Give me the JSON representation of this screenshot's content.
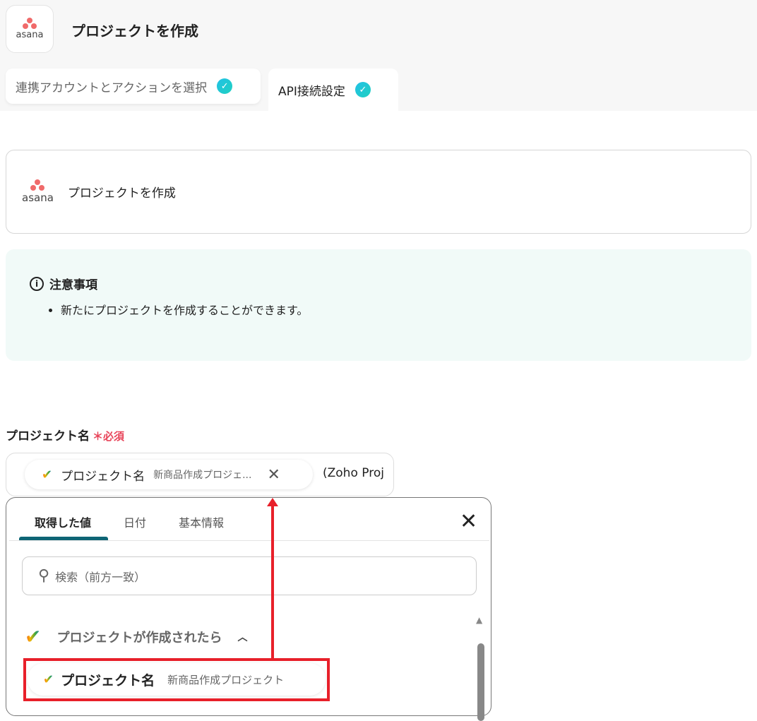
{
  "header": {
    "title": "プロジェクトを作成",
    "logo_text": "asana"
  },
  "tabs": [
    {
      "label": "連携アカウントとアクションを選択"
    },
    {
      "label": "API接続設定"
    }
  ],
  "action_card": {
    "title": "プロジェクトを作成",
    "logo_text": "asana"
  },
  "notice": {
    "title": "注意事項",
    "items": [
      "新たにプロジェクトを作成することができます。"
    ]
  },
  "field": {
    "label": "プロジェクト名",
    "required": "必須",
    "pill_label": "プロジェクト名",
    "pill_value": "新商品作成プロジェ...",
    "trailing_text": "(Zoho Proj"
  },
  "popup": {
    "tabs": [
      "取得した値",
      "日付",
      "基本情報"
    ],
    "search_placeholder": "検索（前方一致）",
    "group": "プロジェクトが作成されたら",
    "item": {
      "label": "プロジェクト名",
      "value": "新商品作成プロジェクト"
    }
  },
  "colors": {
    "accent": "#0e6575",
    "highlight": "#e8202a",
    "required": "#e8455a"
  }
}
